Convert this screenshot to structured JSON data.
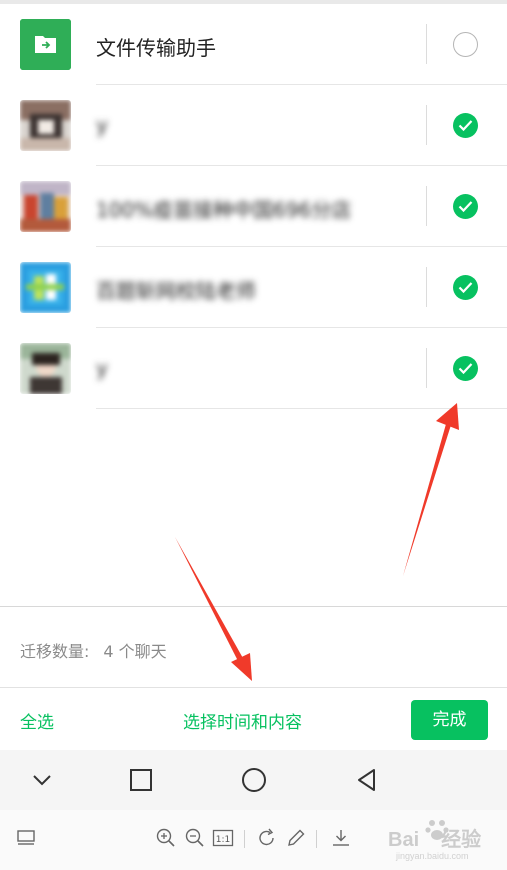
{
  "chats": [
    {
      "name": "文件传输助手",
      "selected": false,
      "avatar": "file-transfer-icon"
    },
    {
      "name": "y",
      "selected": true,
      "avatar": "blurred-photo"
    },
    {
      "name": "100%疫苗接种中国696分店",
      "selected": true,
      "avatar": "blurred-photo"
    },
    {
      "name": "百题斩网校陆老师",
      "selected": true,
      "avatar": "blurred-logo"
    },
    {
      "name": "y",
      "selected": true,
      "avatar": "blurred-photo"
    }
  ],
  "summary": {
    "label": "迁移数量:",
    "count": "4 个聊天"
  },
  "actions": {
    "select_all": "全选",
    "select_time_content": "选择时间和内容",
    "done": "完成"
  },
  "navbar": {
    "icons": [
      "chevron-down-icon",
      "square-icon",
      "circle-icon",
      "back-triangle-icon"
    ]
  },
  "toolbar": {
    "icons": [
      "layout-icon",
      "zoom-in-icon",
      "zoom-out-icon",
      "actual-size-icon",
      "rotate-icon",
      "pencil-icon",
      "download-icon"
    ],
    "actual_size_label": "1:1"
  },
  "watermark": {
    "text": "Bai",
    "text2": "经验",
    "sub": "jingyan.baidu.com"
  },
  "colors": {
    "accent": "#07c160",
    "arrow": "#f03a2a"
  }
}
